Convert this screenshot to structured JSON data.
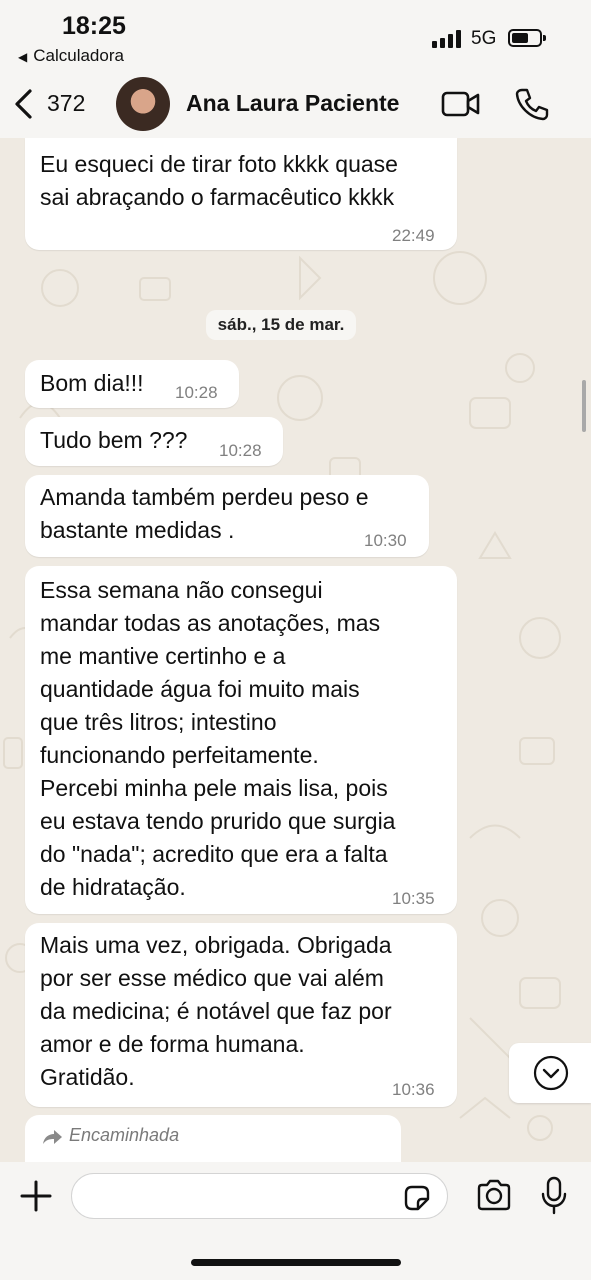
{
  "status_bar": {
    "time": "18:25",
    "back_app": "Calculadora",
    "network": "5G"
  },
  "header": {
    "back_count": "372",
    "contact_name": "Ana Laura Paciente",
    "icons": [
      "back-chevron-icon",
      "video-call-icon",
      "phone-call-icon"
    ]
  },
  "chat": {
    "date_chip": "sáb., 15 de mar.",
    "messages": [
      {
        "text": "Eu esqueci de tirar foto kkkk quase\nsai abraçando o farmacêutico kkkk",
        "time": "22:49"
      },
      {
        "text": "Bom dia!!!",
        "time": "10:28"
      },
      {
        "text": "Tudo bem ???",
        "time": "10:28"
      },
      {
        "text": "Amanda também perdeu peso e\nbastante medidas .",
        "time": "10:30"
      },
      {
        "text": "Essa semana não consegui\nmandar todas as anotações, mas\nme mantive certinho e a\nquantidade água foi muito mais\nque três litros; intestino\nfuncionando perfeitamente.\nPercebi minha pele mais lisa, pois\neu estava tendo prurido que surgia\ndo \"nada\"; acredito que era a falta\nde hidratação.",
        "time": "10:35"
      },
      {
        "text": "Mais uma vez, obrigada. Obrigada\npor ser esse médico que vai além\nda medicina; é notável que  faz por\namor e de forma humana.\nGratidão.",
        "time": "10:36"
      }
    ],
    "forwarded_label": "Encaminhada"
  },
  "composer": {
    "placeholder": "",
    "icons": [
      "plus-icon",
      "sticker-icon",
      "camera-icon",
      "microphone-icon"
    ]
  },
  "colors": {
    "bubble": "#ffffff",
    "chat_bg": "#efeae2",
    "timestamp": "#808080"
  }
}
